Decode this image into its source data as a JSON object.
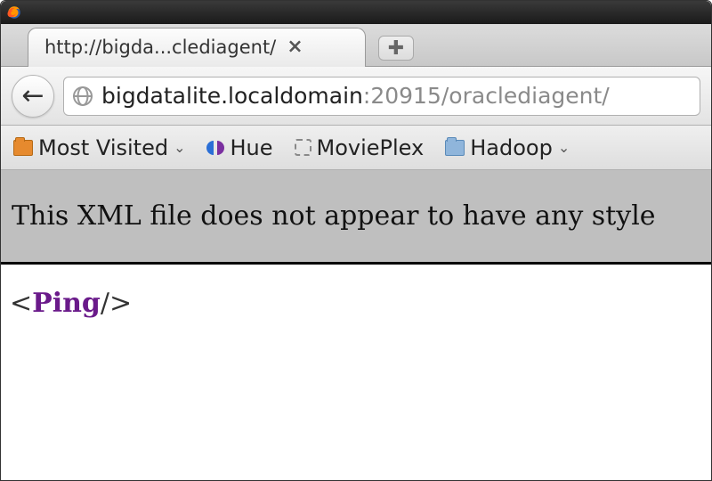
{
  "titlebar": {
    "app": "Firefox"
  },
  "tabs": {
    "active": {
      "title": "http://bigda...clediagent/"
    }
  },
  "url": {
    "host": "bigdatalite.localdomain",
    "port": "20915",
    "path": "/oraclediagent/"
  },
  "bookmarks": {
    "most_visited": "Most Visited",
    "hue": "Hue",
    "movieplex": "MoviePlex",
    "hadoop": "Hadoop"
  },
  "page": {
    "banner": "This XML file does not appear to have any style",
    "xml_tag": "Ping"
  }
}
